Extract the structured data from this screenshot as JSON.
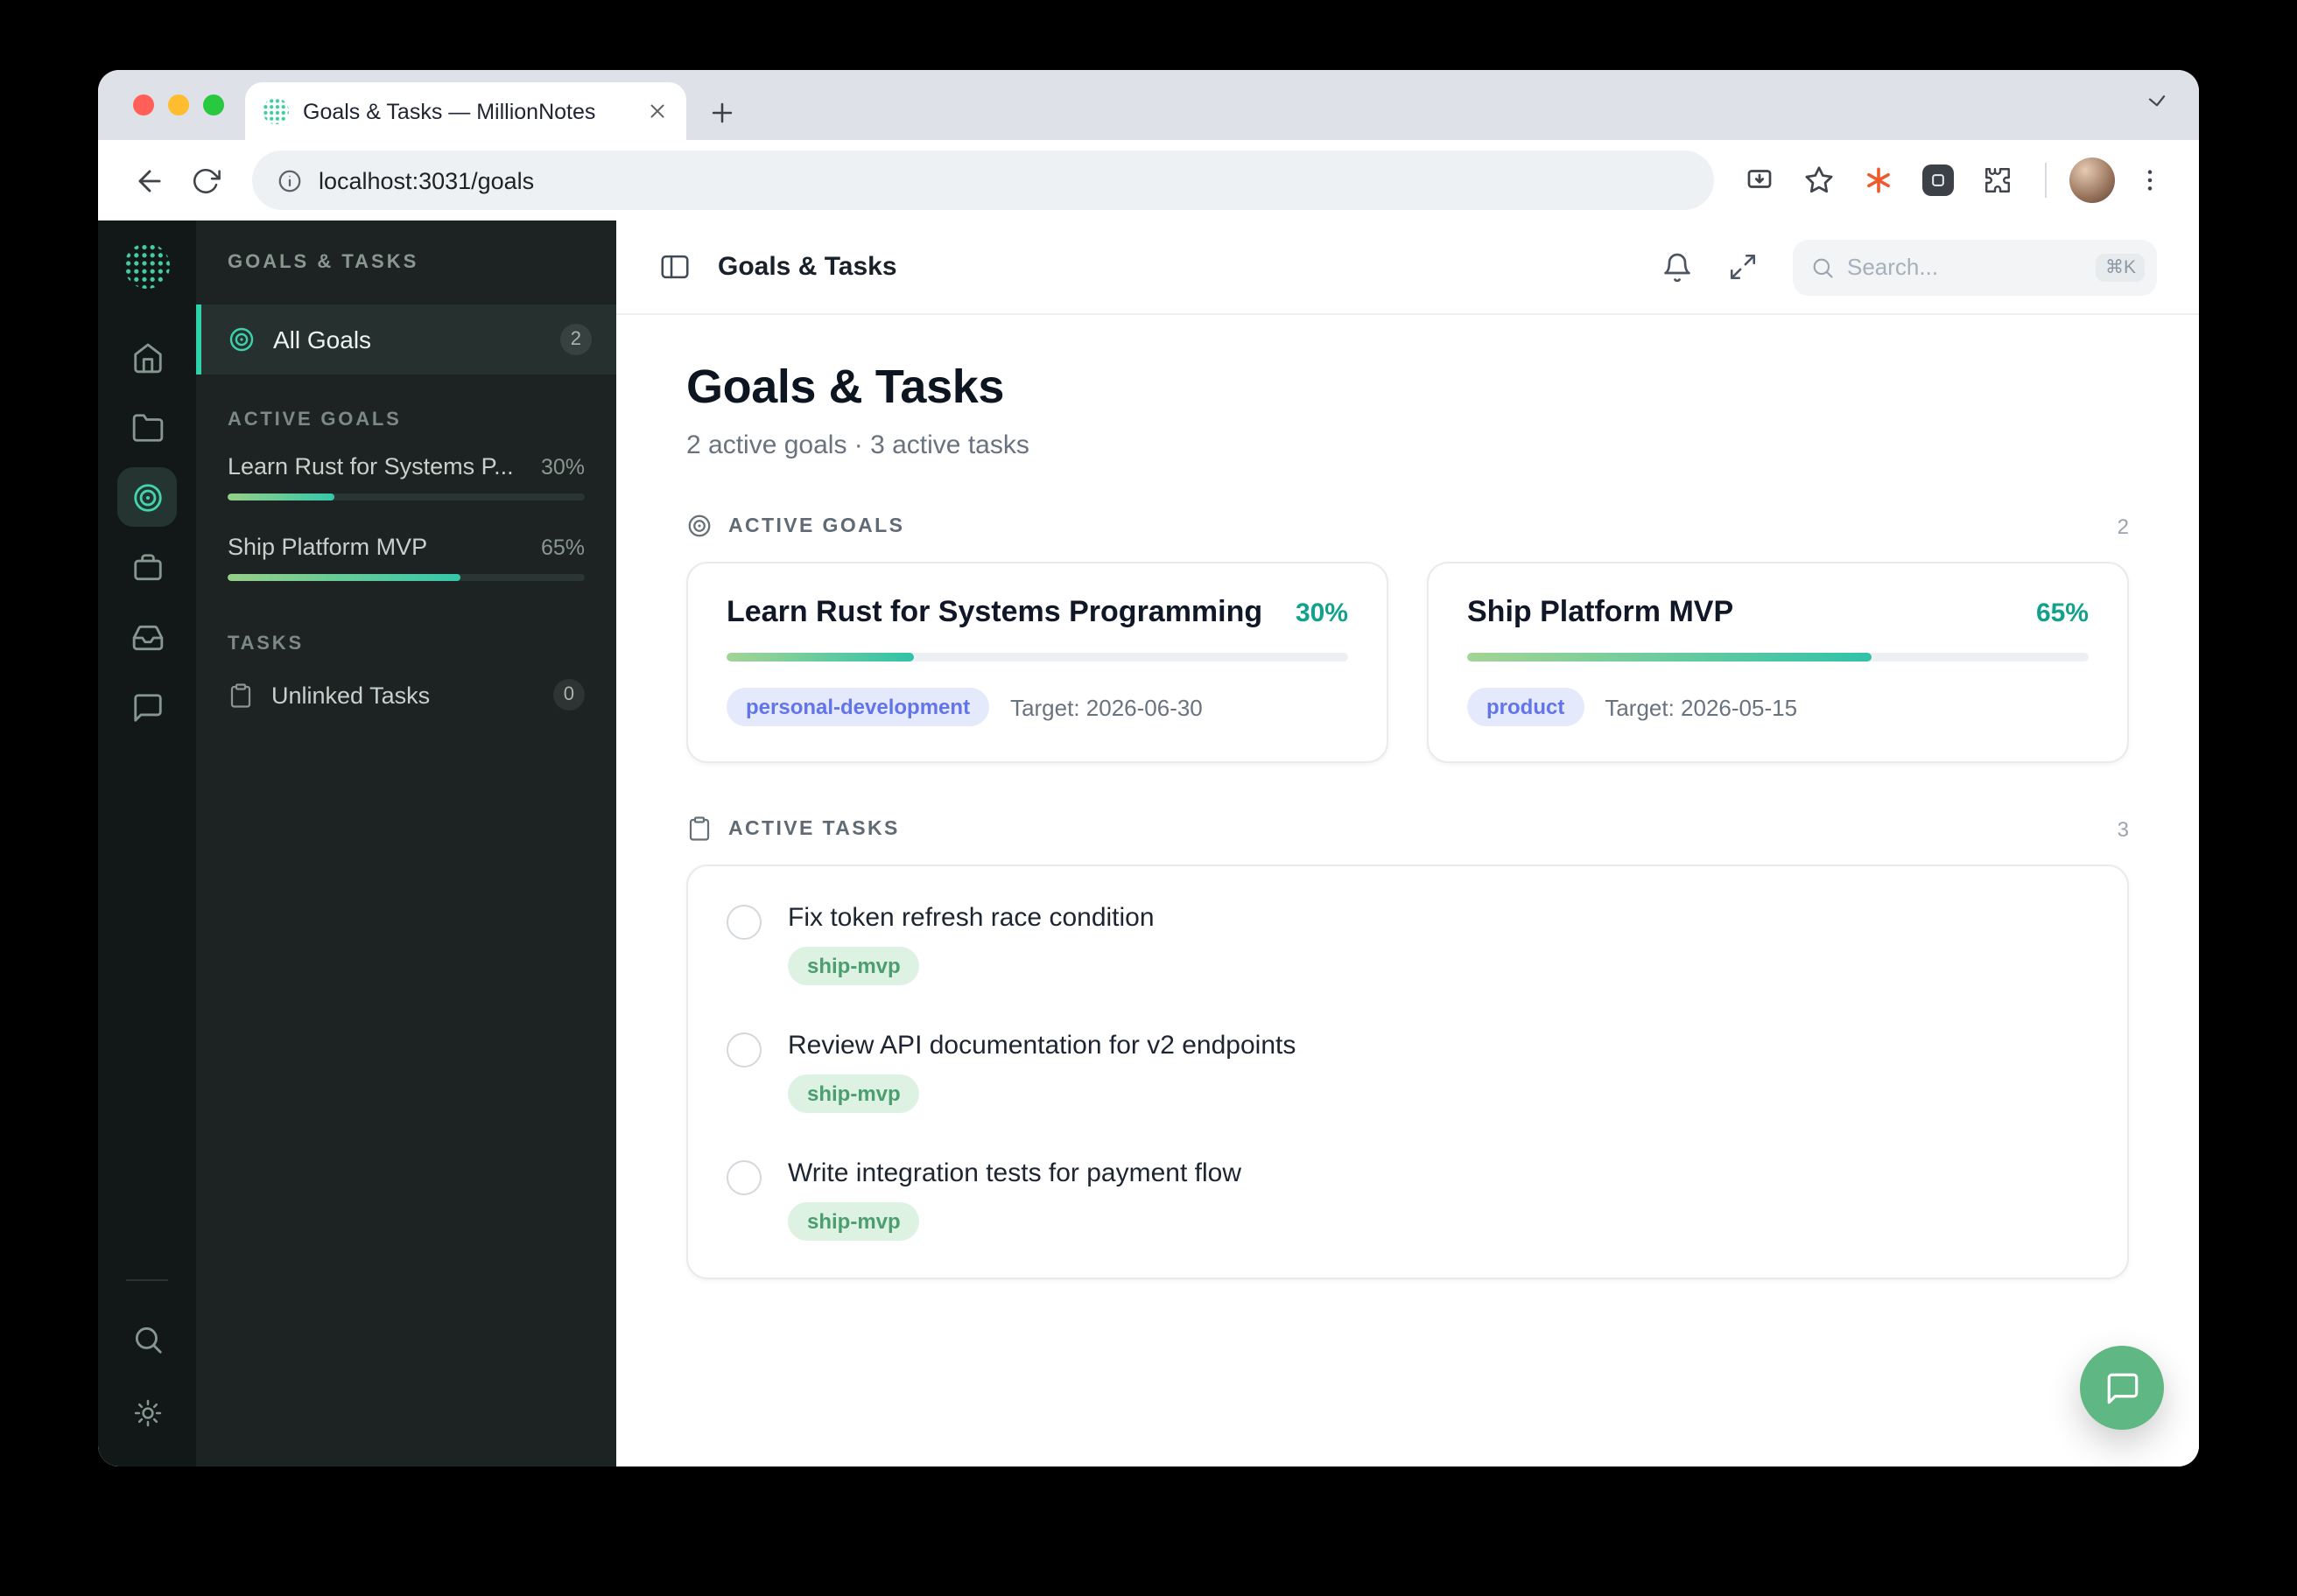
{
  "browser": {
    "tab_title": "Goals & Tasks — MillionNotes",
    "url": "localhost:3031/goals"
  },
  "app_sidebar": {
    "header": "GOALS & TASKS",
    "all_goals_label": "All Goals",
    "all_goals_count": "2",
    "active_goals_label": "ACTIVE GOALS",
    "tasks_label": "TASKS",
    "goals": [
      {
        "label": "Learn Rust for Systems P...",
        "pct": 30,
        "pct_label": "30%"
      },
      {
        "label": "Ship Platform MVP",
        "pct": 65,
        "pct_label": "65%"
      }
    ],
    "unlinked_label": "Unlinked Tasks",
    "unlinked_count": "0"
  },
  "main": {
    "header_title": "Goals & Tasks",
    "search_placeholder": "Search...",
    "search_shortcut": "⌘K",
    "page_title": "Goals & Tasks",
    "page_subtitle": "2 active goals · 3 active tasks",
    "goals_section_label": "ACTIVE GOALS",
    "goals_section_count": "2",
    "tasks_section_label": "ACTIVE TASKS",
    "tasks_section_count": "3",
    "goals": [
      {
        "title": "Learn Rust for Systems Programming",
        "pct": 30,
        "pct_label": "30%",
        "tag": "personal-development",
        "target": "Target: 2026-06-30"
      },
      {
        "title": "Ship Platform MVP",
        "pct": 65,
        "pct_label": "65%",
        "tag": "product",
        "target": "Target: 2026-05-15"
      }
    ],
    "tasks": [
      {
        "title": "Fix token refresh race condition",
        "tag": "ship-mvp"
      },
      {
        "title": "Review API documentation for v2 endpoints",
        "tag": "ship-mvp"
      },
      {
        "title": "Write integration tests for payment flow",
        "tag": "ship-mvp"
      }
    ]
  },
  "colors": {
    "accent_teal": "#12a28c",
    "progress_from": "#a3d494",
    "progress_to": "#30c2a9",
    "tag_blue_bg": "#e4e9fc",
    "tag_blue_text": "#6274e9",
    "tag_green_bg": "#def2e4",
    "tag_green_text": "#4b9e6d",
    "fab_green": "#5fb884",
    "sidebar_bg": "#1c2322",
    "rail_bg": "#121817"
  }
}
